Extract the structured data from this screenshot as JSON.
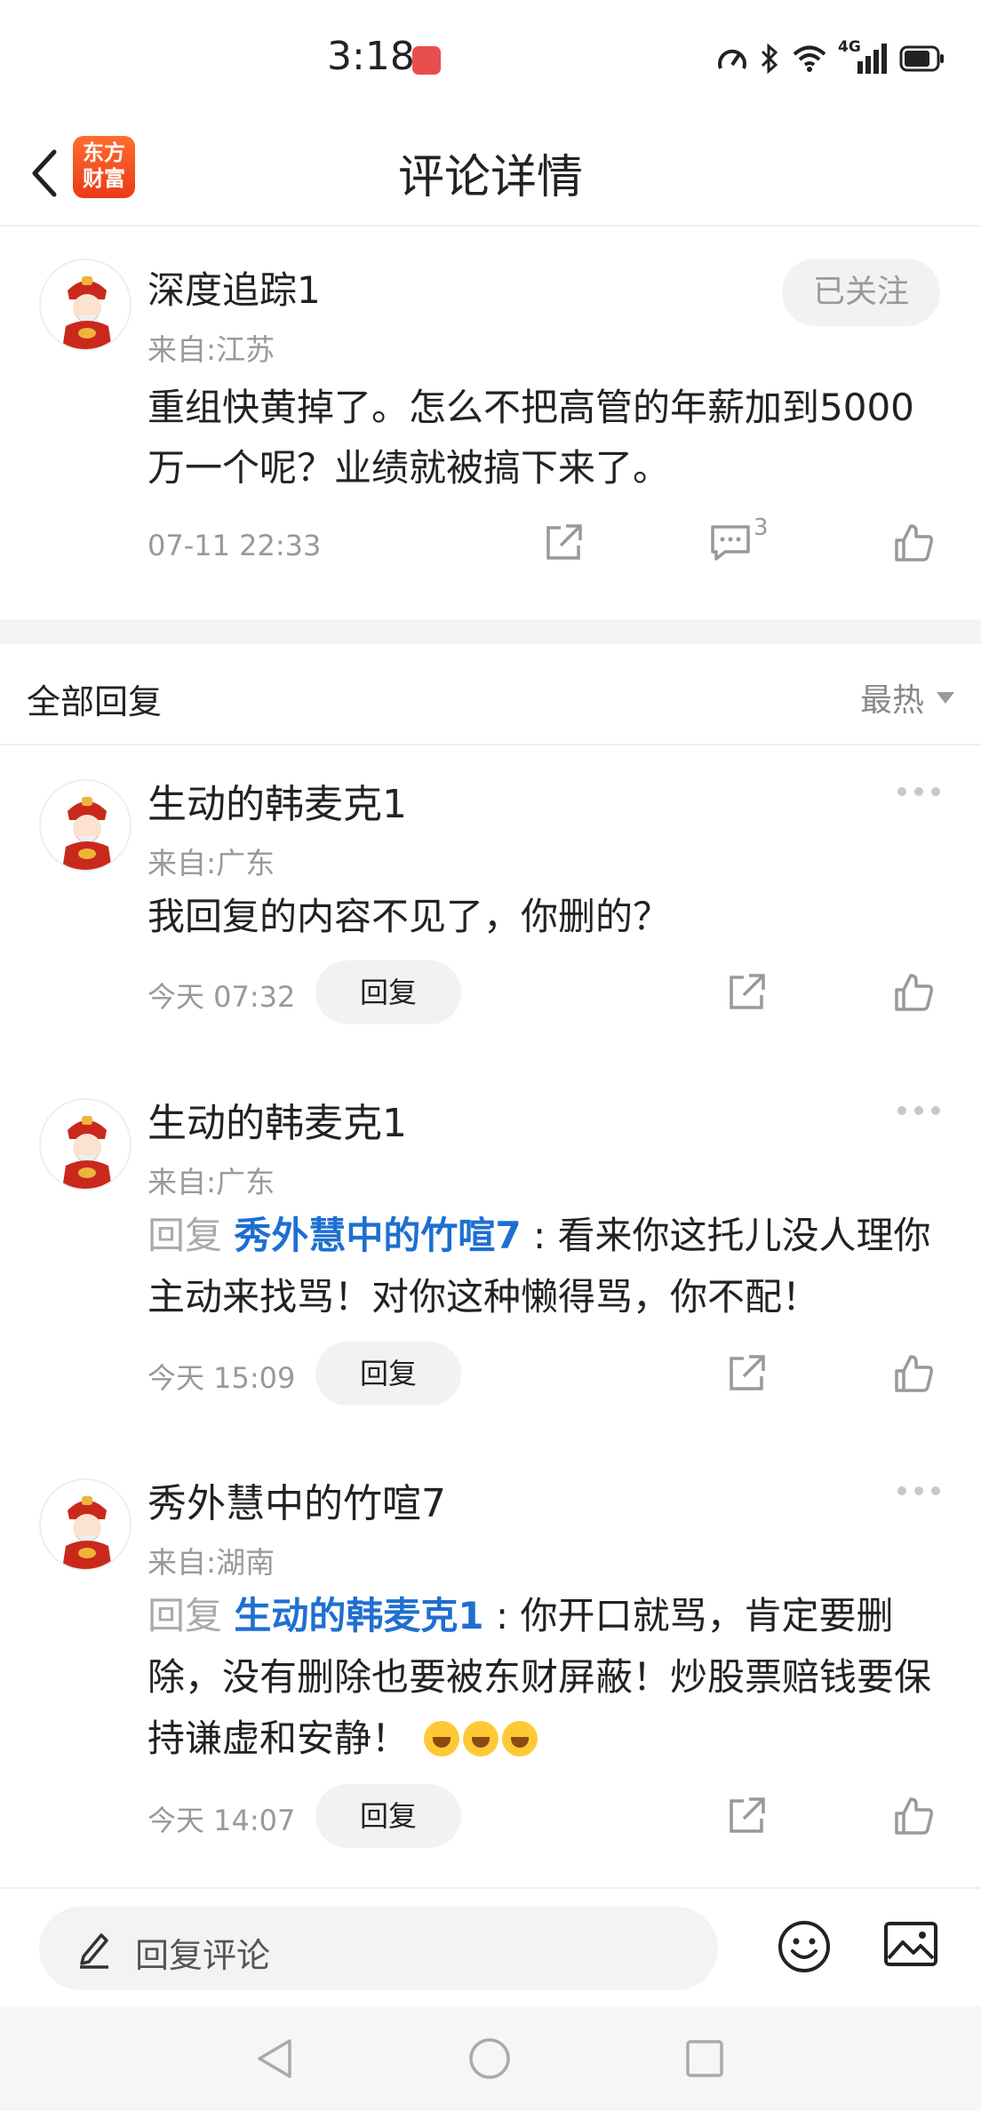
{
  "status_bar": {
    "time": "3:18",
    "network": "4G"
  },
  "header": {
    "title": "评论详情",
    "logo_line1": "东方",
    "logo_line2": "财富"
  },
  "main_post": {
    "author": "深度追踪1",
    "location": "来自:江苏",
    "follow_label": "已关注",
    "content": "重组快黄掉了。怎么不把高管的年薪加到5000万一个呢？业绩就被搞下来了。",
    "time": "07-11 22:33",
    "comment_count": "3"
  },
  "replies_section": {
    "title": "全部回复",
    "sort_label": "最热"
  },
  "replies": [
    {
      "author": "生动的韩麦克1",
      "location": "来自:广东",
      "prefix": "",
      "target": "",
      "separator": "",
      "text": "我回复的内容不见了，你删的？",
      "time": "今天 07:32",
      "reply_label": "回复"
    },
    {
      "author": "生动的韩麦克1",
      "location": "来自:广东",
      "prefix": "回复 ",
      "target": "秀外慧中的竹喧7",
      "separator": " : ",
      "text": "看来你这托儿没人理你主动来找骂！对你这种懒得骂，你不配！",
      "time": "今天 15:09",
      "reply_label": "回复"
    },
    {
      "author": "秀外慧中的竹喧7",
      "location": "来自:湖南",
      "prefix": "回复 ",
      "target": "生动的韩麦克1",
      "separator": " : ",
      "text": "你开口就骂，肯定要删除，没有删除也要被东财屏蔽！炒股票赔钱要保持谦虚和安静！",
      "emoji_icons": [
        "laughing-crying-emoji",
        "laughing-crying-emoji",
        "laughing-crying-emoji"
      ],
      "time": "今天 14:07",
      "reply_label": "回复"
    }
  ],
  "bottom_bar": {
    "input_placeholder": "回复评论"
  },
  "icons": {
    "back": "back-arrow-icon",
    "share": "share-icon",
    "comment": "comment-icon",
    "like": "thumbs-up-icon",
    "more": "more-dots-icon",
    "pencil": "pencil-icon",
    "emoji": "emoji-icon",
    "image": "image-icon"
  },
  "colors": {
    "link": "#1e6fd0",
    "brand": "#ea3a1a",
    "muted": "#999999"
  }
}
